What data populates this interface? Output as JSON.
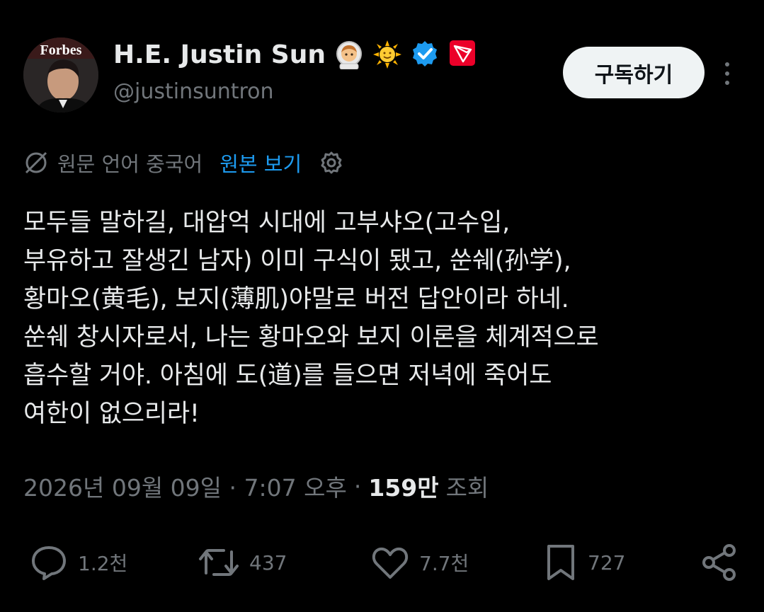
{
  "user": {
    "display_name": "H.E. Justin Sun",
    "handle": "@justinsuntron",
    "avatar_text": "Forbes"
  },
  "header": {
    "subscribe_label": "구독하기"
  },
  "translation": {
    "source_language": "원문 언어 중국어",
    "show_original": "원본 보기"
  },
  "tweet": {
    "text": "모두들 말하길, 대압억 시대에 고부샤오(고수입,\n부유하고 잘생긴 남자) 이미 구식이 됐고, 쑨쉐(孙学),\n황마오(黄毛), 보지(薄肌)야말로 버전 답안이라 하네.\n쑨쉐 창시자로서, 나는 황마오와 보지 이론을 체계적으로\n흡수할 거야. 아침에 도(道)를 들으면 저녁에 죽어도\n여한이 없으리라!"
  },
  "meta": {
    "datetime": "2026년 09월 09일 · 7:07 오후",
    "separator": "·",
    "views_count": "159만",
    "views_label": "조회"
  },
  "actions": {
    "replies": "1.2천",
    "reposts": "437",
    "likes": "7.7천",
    "bookmarks": "727"
  },
  "colors": {
    "background": "#000000",
    "text": "#e7e9ea",
    "muted": "#71767b",
    "link": "#1d9bf0",
    "verified": "#1d9bf0",
    "tron_red": "#eb0029"
  }
}
